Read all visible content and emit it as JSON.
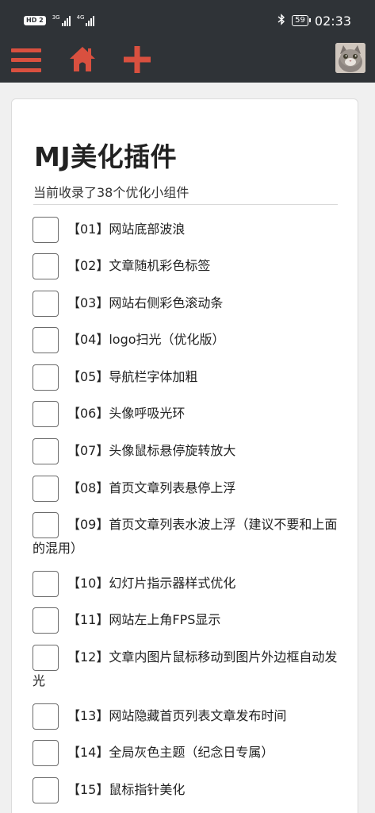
{
  "status_bar": {
    "hd_badge": "HD 2",
    "signal_1_label": "3G",
    "signal_2_label": "4G",
    "bluetooth_icon": "bluetooth-icon",
    "battery_level": "59",
    "time": "02:33"
  },
  "nav": {
    "menu_icon": "hamburger-menu-icon",
    "home_icon": "home-icon",
    "add_icon": "plus-icon",
    "accent_color": "#d9503f",
    "background_color": "#2f3337"
  },
  "main": {
    "title": "MJ美化插件",
    "subtitle": "当前收录了38个优化小组件",
    "items": [
      {
        "label": "【01】网站底部波浪",
        "checked": false
      },
      {
        "label": "【02】文章随机彩色标签",
        "checked": false
      },
      {
        "label": "【03】网站右侧彩色滚动条",
        "checked": false
      },
      {
        "label": "【04】logo扫光（优化版）",
        "checked": false
      },
      {
        "label": "【05】导航栏字体加粗",
        "checked": false
      },
      {
        "label": "【06】头像呼吸光环",
        "checked": false
      },
      {
        "label": "【07】头像鼠标悬停旋转放大",
        "checked": false
      },
      {
        "label": "【08】首页文章列表悬停上浮",
        "checked": false
      },
      {
        "label": "【09】首页文章列表水波上浮（建议不要和上面的混用）",
        "checked": false
      },
      {
        "label": "【10】幻灯片指示器样式优化",
        "checked": false
      },
      {
        "label": "【11】网站左上角FPS显示",
        "checked": false
      },
      {
        "label": "【12】文章内图片鼠标移动到图片外边框自动发光",
        "checked": false
      },
      {
        "label": "【13】网站隐藏首页列表文章发布时间",
        "checked": false
      },
      {
        "label": "【14】全局灰色主题（纪念日专属）",
        "checked": false
      },
      {
        "label": "【15】鼠标指针美化",
        "checked": false
      }
    ]
  }
}
